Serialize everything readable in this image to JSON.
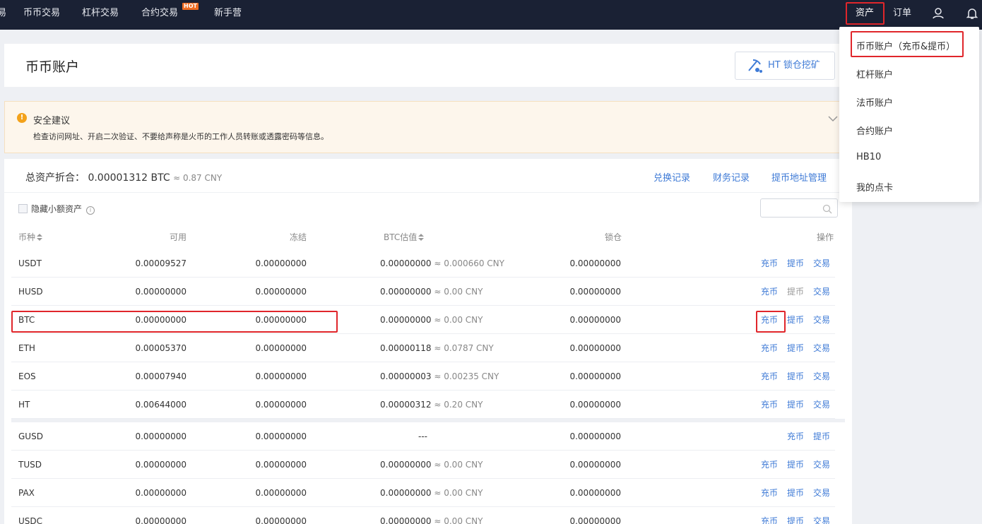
{
  "nav": {
    "items": [
      "易",
      "币币交易",
      "杠杆交易",
      "合约交易",
      "新手营"
    ],
    "hot_badge": "HOT",
    "assets": "资产",
    "orders": "订单"
  },
  "account": {
    "title": "币币账户",
    "mine_button": "HT 锁仓挖矿"
  },
  "alert": {
    "title": "安全建议",
    "text": "检查访问网址、开启二次验证、不要给声称是火币的工作人员转账或透露密码等信息。"
  },
  "summary": {
    "label": "总资产折合：",
    "btc": "0.00001312 BTC",
    "cny": "≈ 0.87 CNY",
    "links": [
      "兑换记录",
      "财务记录",
      "提币地址管理"
    ]
  },
  "filter": {
    "hide_small": "隐藏小额资产",
    "search_placeholder": ""
  },
  "table": {
    "headers": [
      "币种",
      "可用",
      "冻结",
      "BTC估值",
      "锁仓",
      "操作"
    ],
    "actions": {
      "deposit": "充币",
      "withdraw": "提币",
      "trade": "交易"
    },
    "rows": [
      {
        "coin": "USDT",
        "available": "0.00009527",
        "frozen": "0.00000000",
        "btc": "0.00000000",
        "cny": "≈ 0.000660 CNY",
        "locked": "0.00000000"
      },
      {
        "coin": "HUSD",
        "available": "0.00000000",
        "frozen": "0.00000000",
        "btc": "0.00000000",
        "cny": "≈ 0.00 CNY",
        "locked": "0.00000000"
      },
      {
        "coin": "BTC",
        "available": "0.00000000",
        "frozen": "0.00000000",
        "btc": "0.00000000",
        "cny": "≈ 0.00 CNY",
        "locked": "0.00000000"
      },
      {
        "coin": "ETH",
        "available": "0.00005370",
        "frozen": "0.00000000",
        "btc": "0.00000118",
        "cny": "≈ 0.0787 CNY",
        "locked": "0.00000000"
      },
      {
        "coin": "EOS",
        "available": "0.00007940",
        "frozen": "0.00000000",
        "btc": "0.00000003",
        "cny": "≈ 0.00235 CNY",
        "locked": "0.00000000"
      },
      {
        "coin": "HT",
        "available": "0.00644000",
        "frozen": "0.00000000",
        "btc": "0.00000312",
        "cny": "≈ 0.20 CNY",
        "locked": "0.00000000"
      }
    ],
    "rows2": [
      {
        "coin": "GUSD",
        "available": "0.00000000",
        "frozen": "0.00000000",
        "btc": "---",
        "cny": "",
        "locked": "0.00000000"
      },
      {
        "coin": "TUSD",
        "available": "0.00000000",
        "frozen": "0.00000000",
        "btc": "0.00000000",
        "cny": "≈ 0.00 CNY",
        "locked": "0.00000000"
      },
      {
        "coin": "PAX",
        "available": "0.00000000",
        "frozen": "0.00000000",
        "btc": "0.00000000",
        "cny": "≈ 0.00 CNY",
        "locked": "0.00000000"
      },
      {
        "coin": "USDC",
        "available": "0.00000000",
        "frozen": "0.00000000",
        "btc": "0.00000000",
        "cny": "≈ 0.00 CNY",
        "locked": "0.00000000"
      }
    ]
  },
  "dropdown": [
    "币币账户（充币&提币）",
    "杠杆账户",
    "法币账户",
    "合约账户",
    "HB10",
    "我的点卡"
  ],
  "colors": {
    "nav_bg": "#1a2134",
    "accent": "#3e7ad6",
    "highlight": "#e0262b",
    "alert_bg": "#fdf6ec"
  }
}
